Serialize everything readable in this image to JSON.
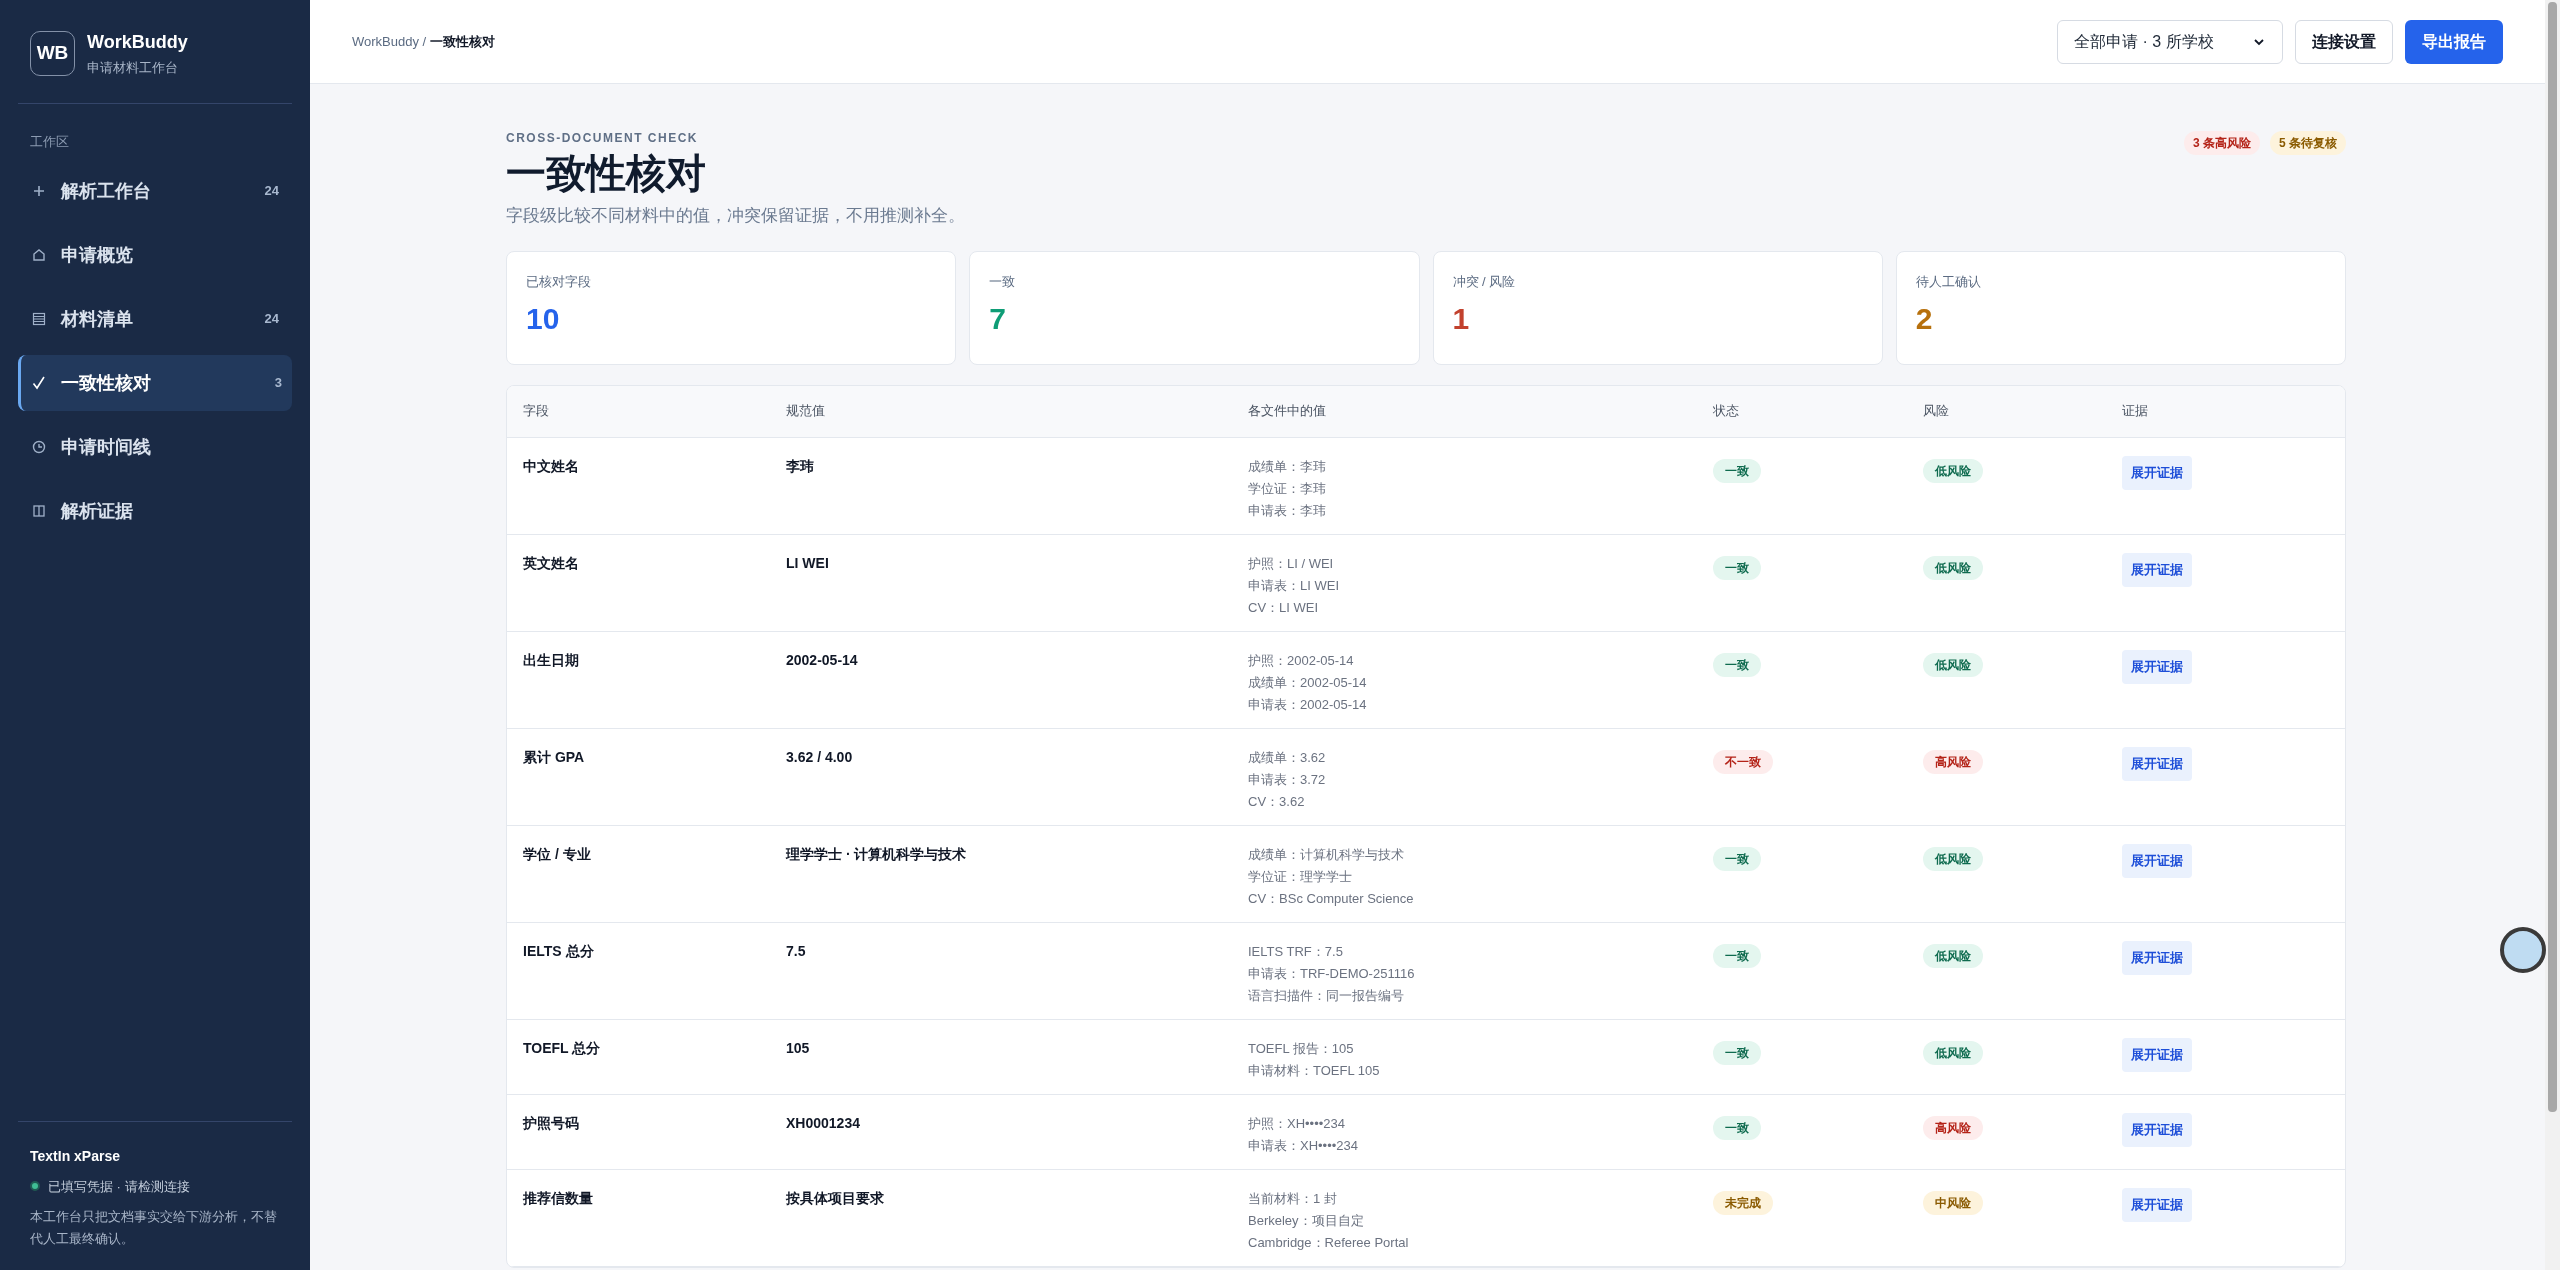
{
  "sidebar": {
    "logo": "WB",
    "app_name": "WorkBuddy",
    "app_subtitle": "申请材料工作台",
    "section_label": "工作区",
    "items": [
      {
        "label": "解析工作台",
        "badge": "24",
        "selected": false
      },
      {
        "label": "申请概览",
        "selected": false
      },
      {
        "label": "材料清单",
        "badge": "24",
        "selected": false
      },
      {
        "label": "一致性核对",
        "badge": "3",
        "selected": true
      },
      {
        "label": "申请时间线",
        "selected": false
      },
      {
        "label": "解析证据",
        "selected": false
      }
    ],
    "footer": {
      "title": "TextIn xParse",
      "status": "已填写凭据 · 请检测连接",
      "note": "本工作台只把文档事实交给下游分析，不替代人工最终确认。"
    }
  },
  "header": {
    "breadcrumb_root": "WorkBuddy /",
    "breadcrumb_current": "一致性核对",
    "scope_select": "全部申请 · 3 所学校",
    "buttons": [
      {
        "label": "连接设置",
        "kind": "secondary"
      },
      {
        "label": "导出报告",
        "kind": "primary"
      }
    ]
  },
  "page": {
    "eyebrow": "CROSS-DOCUMENT CHECK",
    "title": "一致性核对",
    "subtitle": "字段级比较不同材料中的值，冲突保留证据，不用推测补全。",
    "tags": [
      {
        "label": "3 条高风险",
        "kind": "high"
      },
      {
        "label": "5 条待复核",
        "kind": "medium"
      }
    ]
  },
  "stats": [
    {
      "label": "已核对字段",
      "value": "10",
      "color": "#2563eb"
    },
    {
      "label": "一致",
      "value": "7",
      "color": "#0f9d76"
    },
    {
      "label": "冲突 / 风险",
      "value": "1",
      "color": "#c2412d"
    },
    {
      "label": "待人工确认",
      "value": "2",
      "color": "#b7700c"
    }
  ],
  "table": {
    "columns": [
      "字段",
      "规范值",
      "各文件中的值",
      "状态",
      "风险",
      "证据"
    ],
    "rows": [
      {
        "field": "中文姓名",
        "canonical": "李玮",
        "values": [
          "成绩单：李玮",
          "学位证：李玮",
          "申请表：李玮"
        ],
        "status": {
          "label": "一致",
          "kind": "ok"
        },
        "risk": {
          "label": "低风险",
          "kind": "low"
        },
        "action": "展开证据"
      },
      {
        "field": "英文姓名",
        "canonical": "LI WEI",
        "values": [
          "护照：LI / WEI",
          "申请表：LI WEI",
          "CV：LI WEI"
        ],
        "status": {
          "label": "一致",
          "kind": "ok"
        },
        "risk": {
          "label": "低风险",
          "kind": "low"
        },
        "action": "展开证据"
      },
      {
        "field": "出生日期",
        "canonical": "2002-05-14",
        "values": [
          "护照：2002-05-14",
          "成绩单：2002-05-14",
          "申请表：2002-05-14"
        ],
        "status": {
          "label": "一致",
          "kind": "ok"
        },
        "risk": {
          "label": "低风险",
          "kind": "low"
        },
        "action": "展开证据"
      },
      {
        "field": "累计 GPA",
        "canonical": "3.62 / 4.00",
        "values": [
          "成绩单：3.62",
          "申请表：3.72",
          "CV：3.62"
        ],
        "status": {
          "label": "不一致",
          "kind": "conflict"
        },
        "risk": {
          "label": "高风险",
          "kind": "high"
        },
        "action": "展开证据"
      },
      {
        "field": "学位 / 专业",
        "canonical": "理学学士 · 计算机科学与技术",
        "values": [
          "成绩单：计算机科学与技术",
          "学位证：理学学士",
          "CV：BSc Computer Science"
        ],
        "status": {
          "label": "一致",
          "kind": "ok"
        },
        "risk": {
          "label": "低风险",
          "kind": "low"
        },
        "action": "展开证据"
      },
      {
        "field": "IELTS 总分",
        "canonical": "7.5",
        "values": [
          "IELTS TRF：7.5",
          "申请表：TRF-DEMO-251116",
          "语言扫描件：同一报告编号"
        ],
        "status": {
          "label": "一致",
          "kind": "ok"
        },
        "risk": {
          "label": "低风险",
          "kind": "low"
        },
        "action": "展开证据"
      },
      {
        "field": "TOEFL 总分",
        "canonical": "105",
        "values": [
          "TOEFL 报告：105",
          "申请材料：TOEFL 105"
        ],
        "status": {
          "label": "一致",
          "kind": "ok"
        },
        "risk": {
          "label": "低风险",
          "kind": "low"
        },
        "action": "展开证据"
      },
      {
        "field": "护照号码",
        "canonical": "XH0001234",
        "values": [
          "护照：XH••••234",
          "申请表：XH••••234"
        ],
        "status": {
          "label": "一致",
          "kind": "ok"
        },
        "risk": {
          "label": "高风险",
          "kind": "high"
        },
        "action": "展开证据"
      },
      {
        "field": "推荐信数量",
        "canonical": "按具体项目要求",
        "values": [
          "当前材料：1 封",
          "Berkeley：项目自定",
          "Cambridge：Referee Portal"
        ],
        "status": {
          "label": "未完成",
          "kind": "pending"
        },
        "risk": {
          "label": "中风险",
          "kind": "medium"
        },
        "action": "展开证据"
      }
    ]
  }
}
